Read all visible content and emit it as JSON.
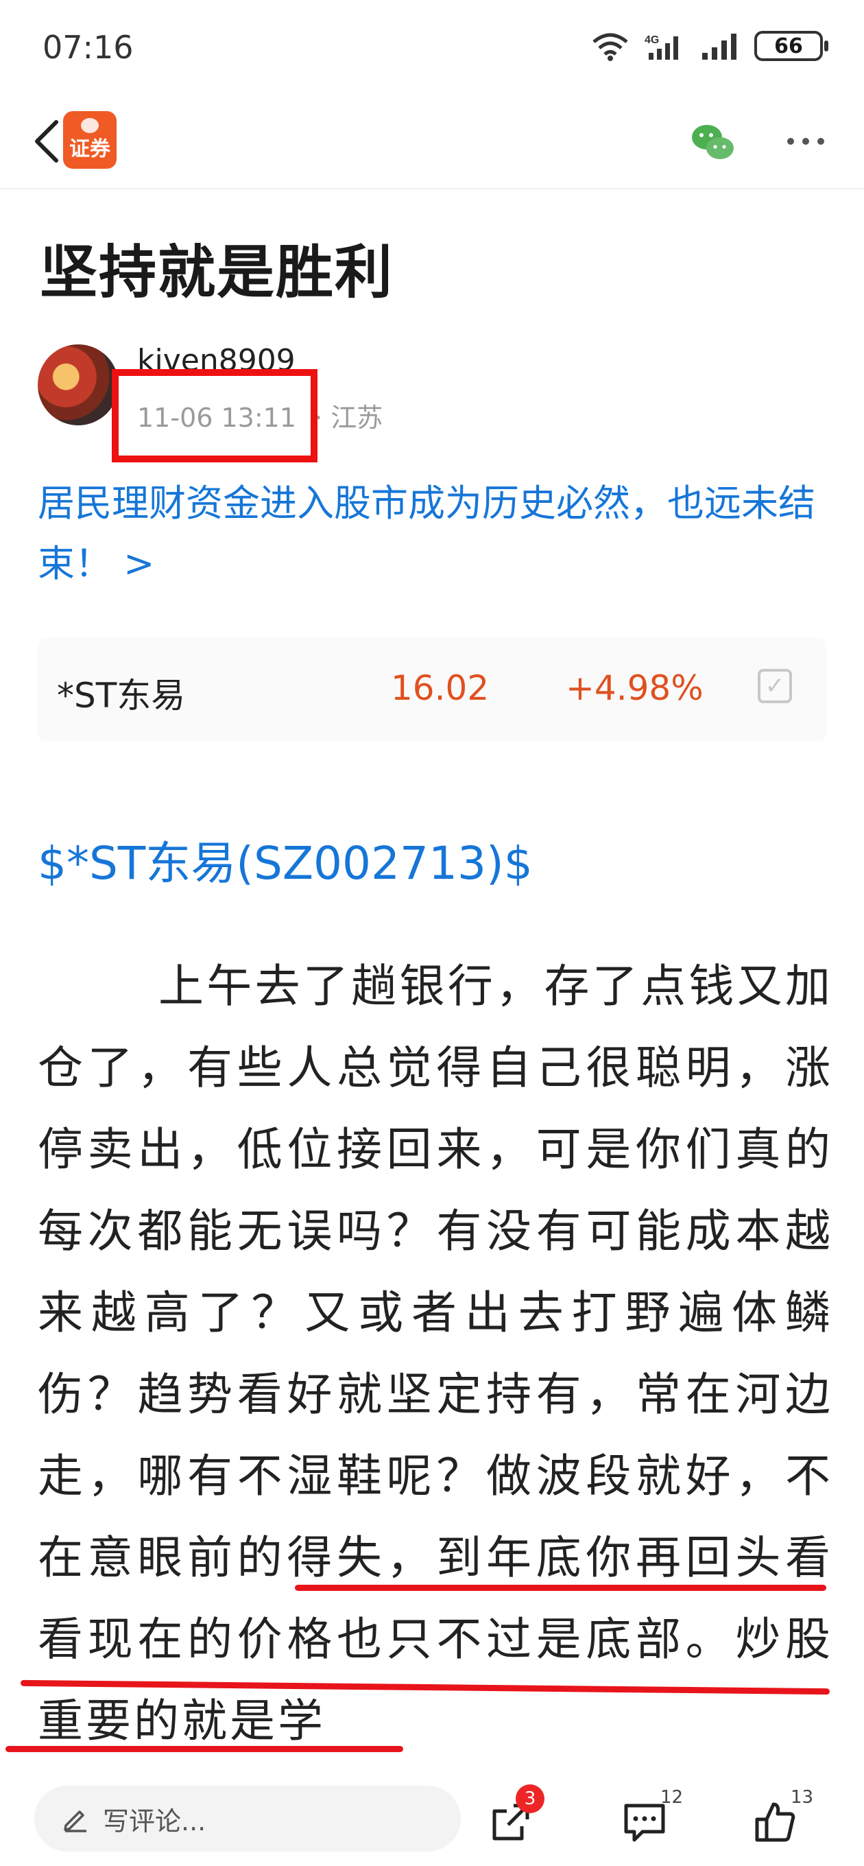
{
  "status_bar": {
    "time": "07:16",
    "network": "4G",
    "battery": "66"
  },
  "nav": {
    "app_logo_text": "证券"
  },
  "post": {
    "title": "坚持就是胜利",
    "author": "kiven8909",
    "time": "11-06 13:11",
    "location": "· 江苏",
    "topic": "居民理财资金进入股市成为历史必然，也远未结束！ >"
  },
  "stock_card": {
    "name": "*ST东易",
    "price": "16.02",
    "change": "+4.98%"
  },
  "stock_tag": "$*ST东易(SZ002713)$",
  "body": {
    "paragraph": "上午去了趟银行，存了点钱又加仓了，有些人总觉得自己很聪明，涨停卖出，低位接回来，可是你们真的每次都能无误吗？有没有可能成本越来越高了？又或者出去打野遍体鳞伤？趋势看好就坚定持有，常在河边走，哪有不湿鞋呢？做波段就好，不在意眼前的得失，到年底你再回头看看现在的价格也只不过是底部。炒股重要的就是学"
  },
  "bottom_bar": {
    "comment_placeholder": "写评论...",
    "share_badge": "3",
    "comment_count": "12",
    "like_count": "13"
  },
  "colors": {
    "accent_blue": "#1676d8",
    "price_red": "#e0501f",
    "logo_orange": "#f05a24",
    "annotation_red": "#e8141b"
  }
}
